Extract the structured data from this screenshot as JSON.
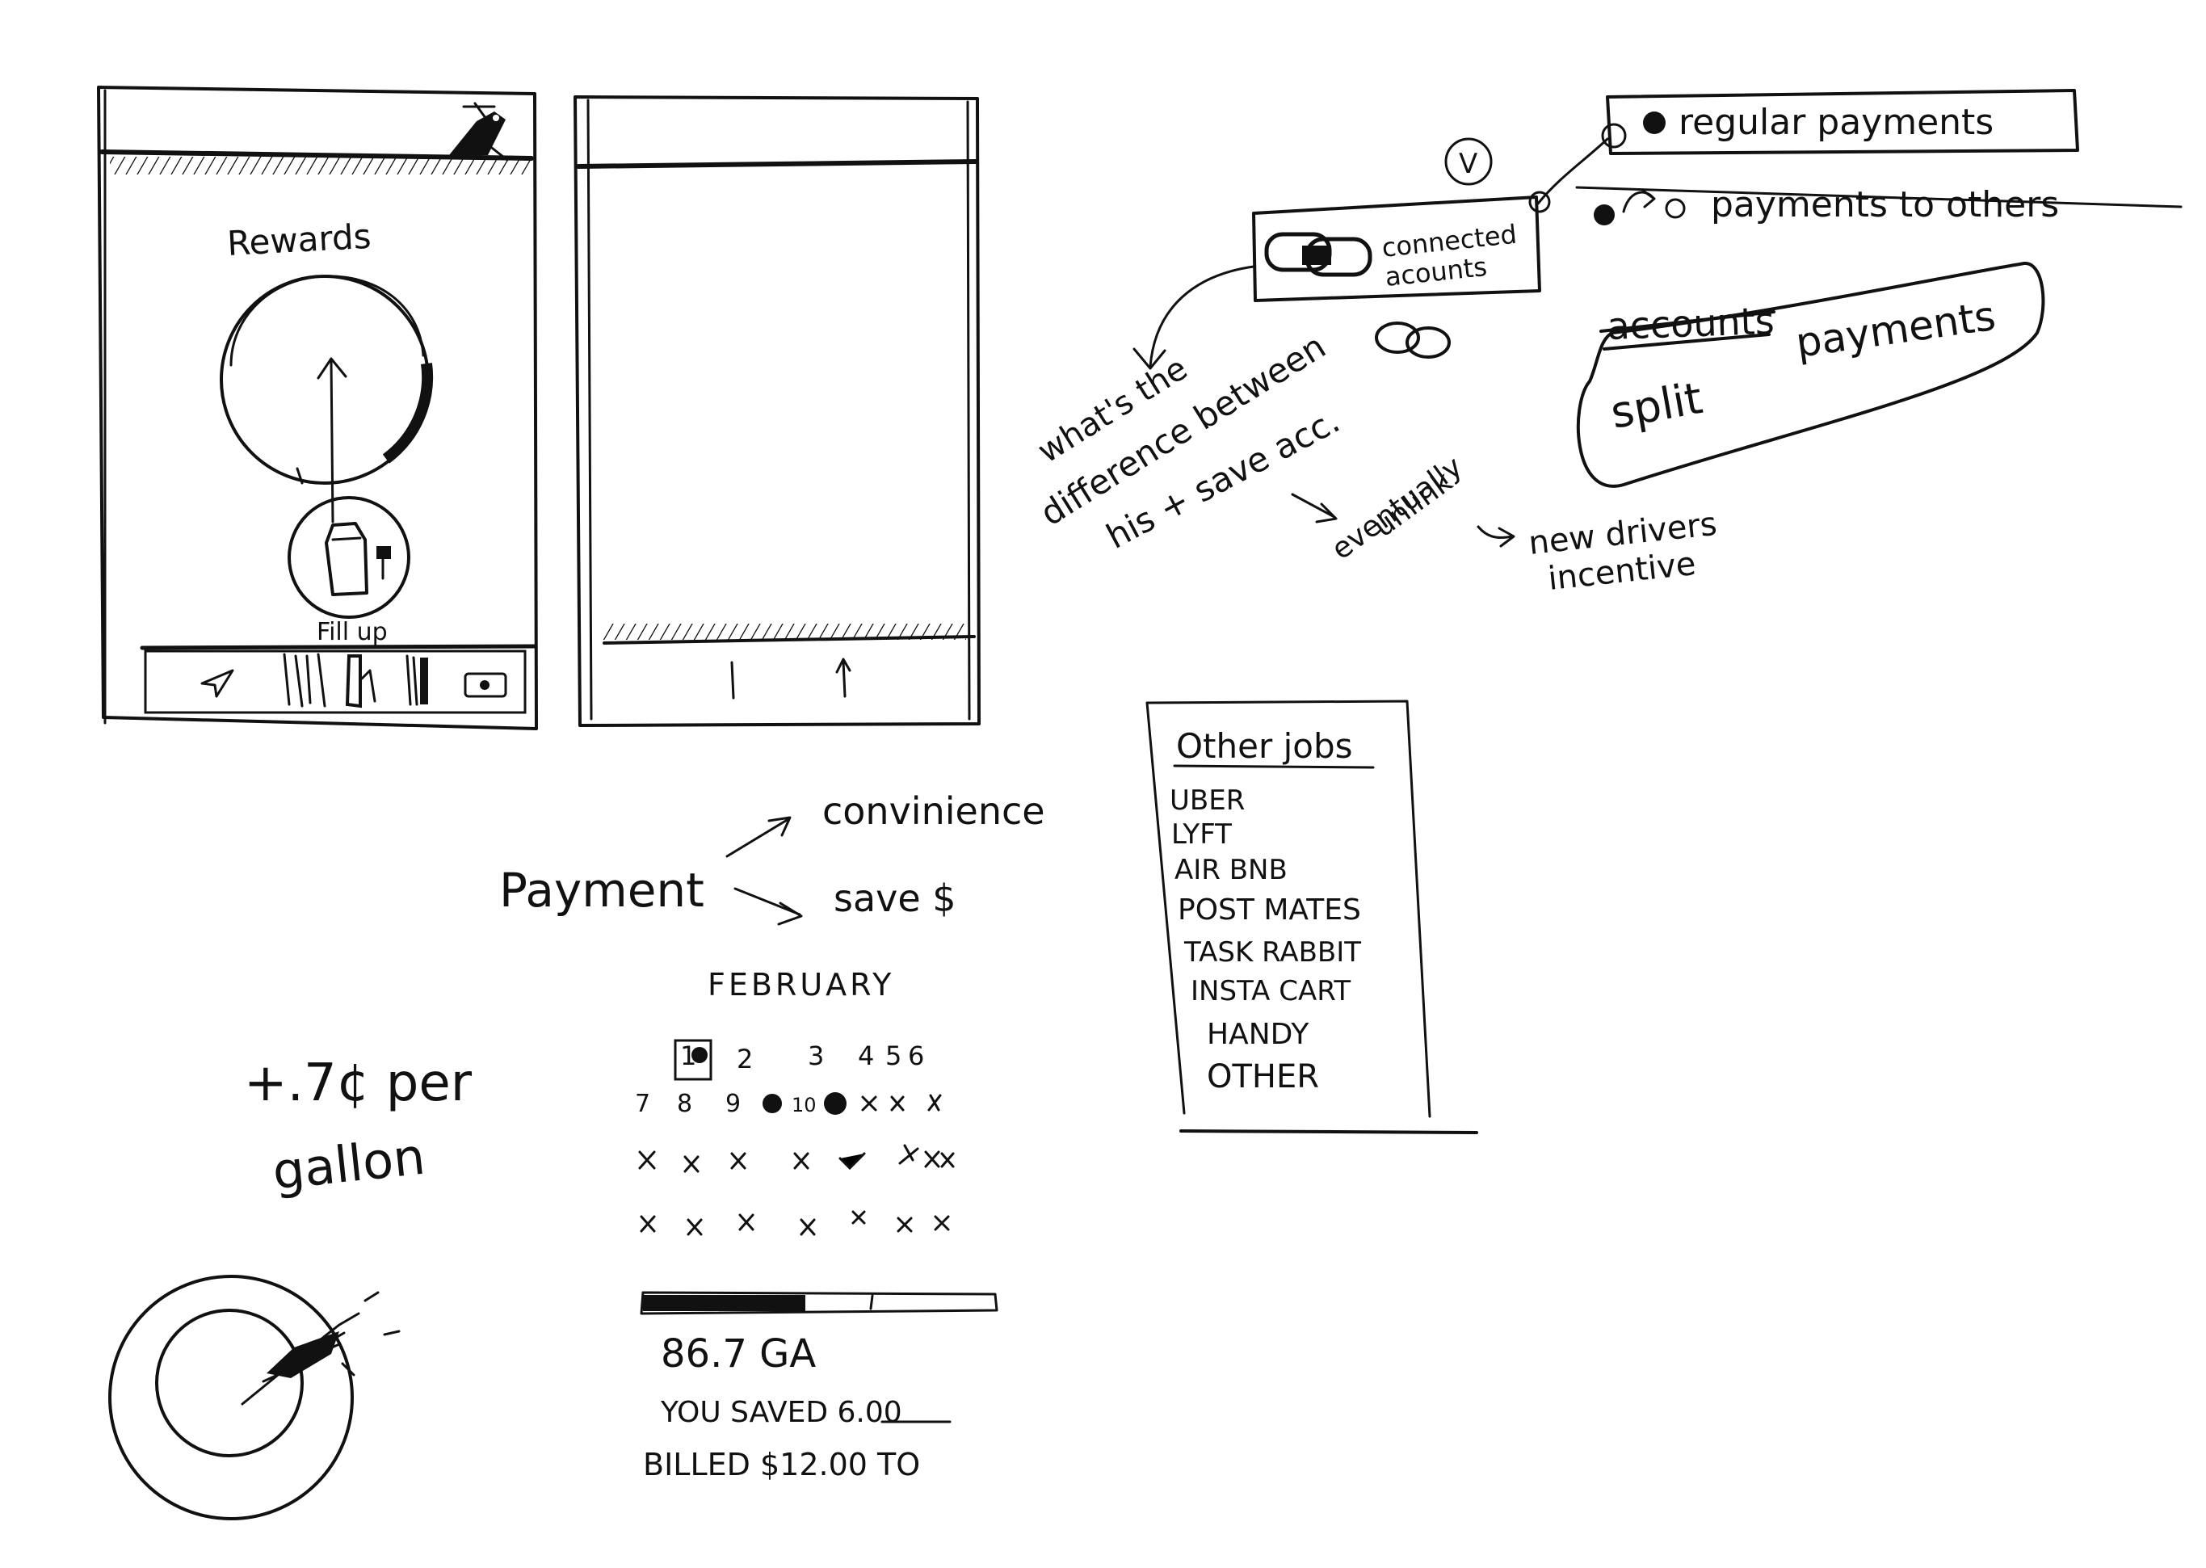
{
  "phone1": {
    "title": "Rewards",
    "button_label": "Fill up"
  },
  "accounts": {
    "label_line1": "connected",
    "label_line2": "acounts",
    "badge": "V",
    "options": [
      "regular payments",
      "payments to others"
    ],
    "split_struck": "accounts",
    "split_word": "split",
    "split_payments": "payments"
  },
  "notes": {
    "question_lines": [
      "what's the",
      "difference between",
      "his + save acc."
    ],
    "eventually": "eventually",
    "unlink": "unlink",
    "new_drivers_line1": "new drivers",
    "new_drivers_line2": "incentive"
  },
  "jobs": {
    "title": "Other jobs",
    "items": [
      "UBER",
      "LYFT",
      "AIR BNB",
      "POST MATES",
      "TASK RABBIT",
      "INSTA CART",
      "HANDY",
      "OTHER"
    ]
  },
  "payment_map": {
    "root": "Payment",
    "branch_a": "convinience",
    "branch_b": "save $"
  },
  "per_gallon": {
    "amount": "+.7¢ per",
    "unit": "gallon"
  },
  "calendar": {
    "month": "FEBRUARY",
    "row1": [
      "1",
      "2",
      "3",
      "4",
      "5",
      "6"
    ],
    "row2": [
      "7",
      "8",
      "9",
      "10"
    ],
    "gallons": "86.7 GA",
    "saved": "YOU SAVED 6.00",
    "billed": "BILLED $12.00 TO",
    "progress": 0.46
  }
}
